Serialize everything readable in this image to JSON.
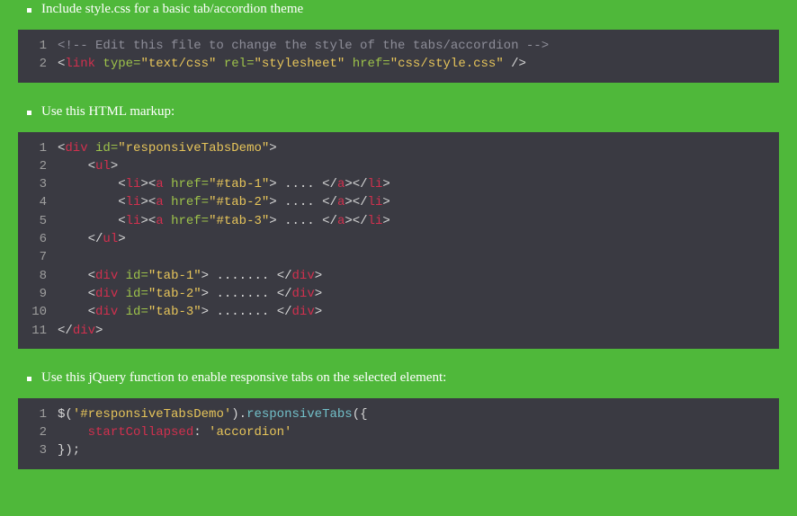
{
  "bullets": {
    "b1": "Include style.css for a basic tab/accordion theme",
    "b2": "Use this HTML markup:",
    "b3": "Use this jQuery function to enable responsive tabs on the selected element:"
  },
  "code1": {
    "n1": "1",
    "n2": "2",
    "l1_comment": "<!-- Edit this file to change the style of the tabs/accordion -->",
    "l2": {
      "open": "<",
      "tag": "link",
      "sp1": " ",
      "a1": "type=",
      "v1": "\"text/css\"",
      "sp2": " ",
      "a2": "rel=",
      "v2": "\"stylesheet\"",
      "sp3": " ",
      "a3": "href=",
      "v3": "\"css/style.css\"",
      "close": " />"
    }
  },
  "code2": {
    "nums": {
      "n1": "1",
      "n2": "2",
      "n3": "3",
      "n4": "4",
      "n5": "5",
      "n6": "6",
      "n7": "7",
      "n8": "8",
      "n9": "9",
      "n10": "10",
      "n11": "11"
    },
    "l1": {
      "open": "<",
      "tag": "div",
      "sp": " ",
      "attr": "id=",
      "val": "\"responsiveTabsDemo\"",
      "close": ">"
    },
    "l2": {
      "indent": "    ",
      "open": "<",
      "tag": "ul",
      "close": ">"
    },
    "li1": {
      "indent": "        ",
      "lio": "<",
      "liTag": "li",
      "lic": "><",
      "aTag": "a",
      "sp": " ",
      "attr": "href=",
      "val": "\"#tab-1\"",
      "ac": ">",
      "dots": " .... ",
      "aco": "</",
      "aTag2": "a",
      "acc": "></",
      "liTag2": "li",
      "liclose": ">"
    },
    "li2": {
      "indent": "        ",
      "lio": "<",
      "liTag": "li",
      "lic": "><",
      "aTag": "a",
      "sp": " ",
      "attr": "href=",
      "val": "\"#tab-2\"",
      "ac": ">",
      "dots": " .... ",
      "aco": "</",
      "aTag2": "a",
      "acc": "></",
      "liTag2": "li",
      "liclose": ">"
    },
    "li3": {
      "indent": "        ",
      "lio": "<",
      "liTag": "li",
      "lic": "><",
      "aTag": "a",
      "sp": " ",
      "attr": "href=",
      "val": "\"#tab-3\"",
      "ac": ">",
      "dots": " .... ",
      "aco": "</",
      "aTag2": "a",
      "acc": "></",
      "liTag2": "li",
      "liclose": ">"
    },
    "l6": {
      "indent": "    ",
      "open": "</",
      "tag": "ul",
      "close": ">"
    },
    "l7": {
      "blank": " "
    },
    "d1": {
      "indent": "    ",
      "open": "<",
      "tag": "div",
      "sp": " ",
      "attr": "id=",
      "val": "\"tab-1\"",
      "c1": ">",
      "dots": " ....... ",
      "c2": "</",
      "tag2": "div",
      "c3": ">"
    },
    "d2": {
      "indent": "    ",
      "open": "<",
      "tag": "div",
      "sp": " ",
      "attr": "id=",
      "val": "\"tab-2\"",
      "c1": ">",
      "dots": " ....... ",
      "c2": "</",
      "tag2": "div",
      "c3": ">"
    },
    "d3": {
      "indent": "    ",
      "open": "<",
      "tag": "div",
      "sp": " ",
      "attr": "id=",
      "val": "\"tab-3\"",
      "c1": ">",
      "dots": " ....... ",
      "c2": "</",
      "tag2": "div",
      "c3": ">"
    },
    "l11": {
      "open": "</",
      "tag": "div",
      "close": ">"
    }
  },
  "code3": {
    "n1": "1",
    "n2": "2",
    "n3": "3",
    "l1": {
      "a": "$(",
      "b": "'#responsiveTabsDemo'",
      "c": ").",
      "d": "responsiveTabs",
      "e": "({"
    },
    "l2": {
      "indent": "    ",
      "key": "startCollapsed",
      "colon": ": ",
      "val": "'accordion'"
    },
    "l3": {
      "text": "});"
    }
  }
}
